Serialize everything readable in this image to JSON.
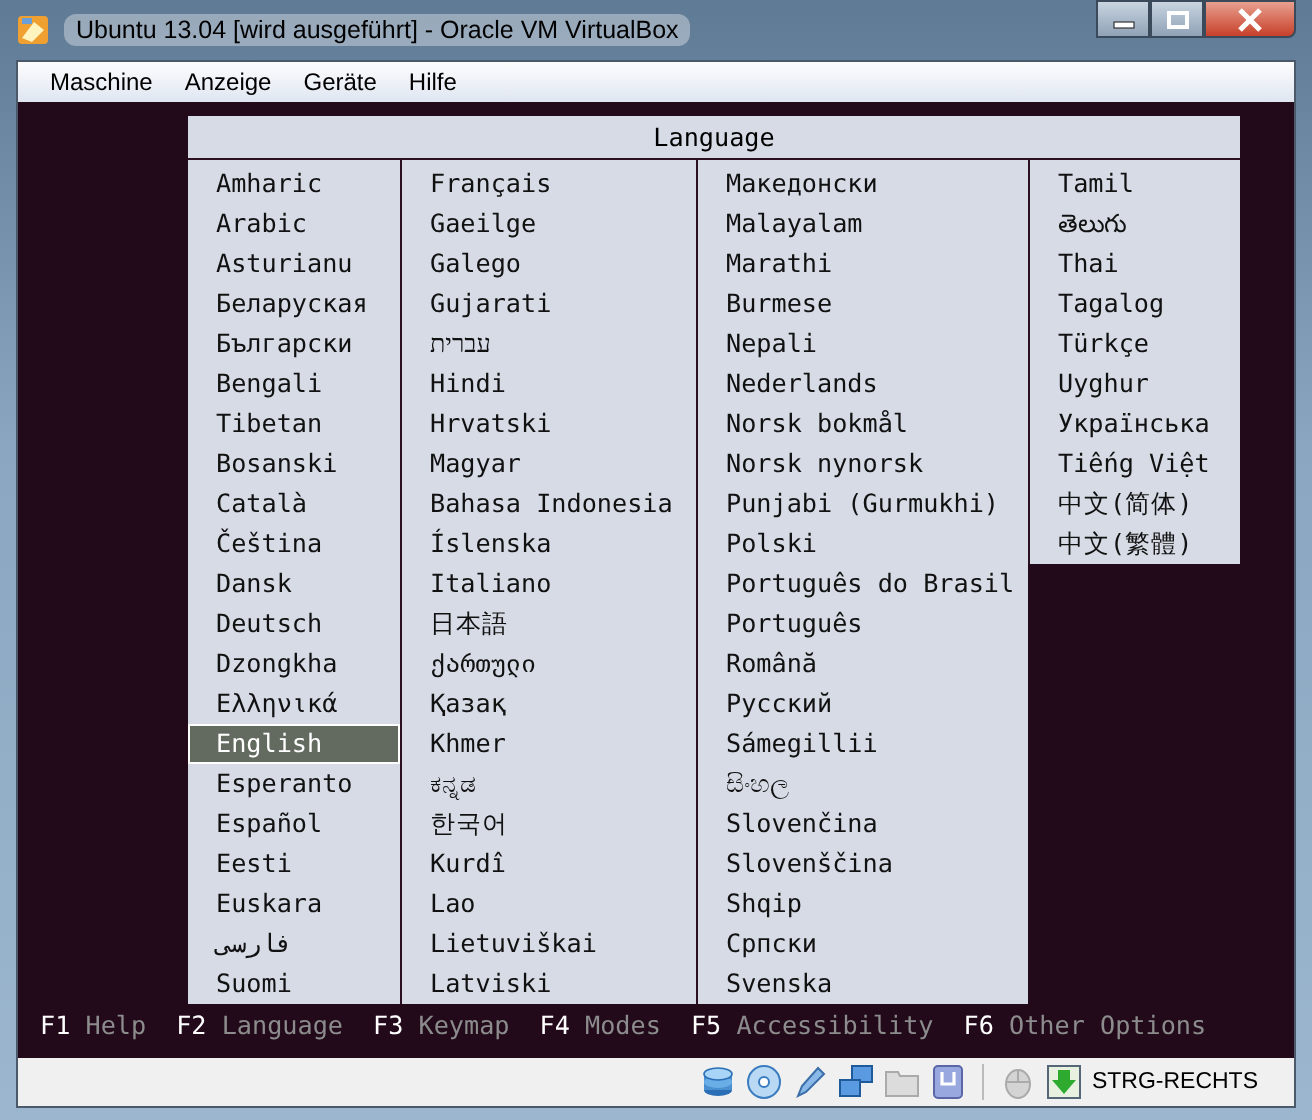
{
  "window": {
    "title": "Ubuntu 13.04 [wird ausgeführt] - Oracle VM VirtualBox"
  },
  "menu": [
    "Maschine",
    "Anzeige",
    "Geräte",
    "Hilfe"
  ],
  "language_menu": {
    "title": "Language",
    "columns": [
      {
        "items": [
          {
            "label": "Amharic",
            "selected": false
          },
          {
            "label": "Arabic",
            "selected": false
          },
          {
            "label": "Asturianu",
            "selected": false
          },
          {
            "label": "Беларуская",
            "selected": false
          },
          {
            "label": "Български",
            "selected": false
          },
          {
            "label": "Bengali",
            "selected": false
          },
          {
            "label": "Tibetan",
            "selected": false
          },
          {
            "label": "Bosanski",
            "selected": false
          },
          {
            "label": "Català",
            "selected": false
          },
          {
            "label": "Čeština",
            "selected": false
          },
          {
            "label": "Dansk",
            "selected": false
          },
          {
            "label": "Deutsch",
            "selected": false
          },
          {
            "label": "Dzongkha",
            "selected": false
          },
          {
            "label": "Ελληνικά",
            "selected": false
          },
          {
            "label": "English",
            "selected": true
          },
          {
            "label": "Esperanto",
            "selected": false
          },
          {
            "label": "Español",
            "selected": false
          },
          {
            "label": "Eesti",
            "selected": false
          },
          {
            "label": "Euskara",
            "selected": false
          },
          {
            "label": "فارسی",
            "selected": false
          },
          {
            "label": "Suomi",
            "selected": false
          }
        ]
      },
      {
        "items": [
          {
            "label": "Français",
            "selected": false
          },
          {
            "label": "Gaeilge",
            "selected": false
          },
          {
            "label": "Galego",
            "selected": false
          },
          {
            "label": "Gujarati",
            "selected": false
          },
          {
            "label": "עברית",
            "selected": false
          },
          {
            "label": "Hindi",
            "selected": false
          },
          {
            "label": "Hrvatski",
            "selected": false
          },
          {
            "label": "Magyar",
            "selected": false
          },
          {
            "label": "Bahasa Indonesia",
            "selected": false
          },
          {
            "label": "Íslenska",
            "selected": false
          },
          {
            "label": "Italiano",
            "selected": false
          },
          {
            "label": "日本語",
            "selected": false
          },
          {
            "label": "ქართული",
            "selected": false
          },
          {
            "label": "Қазақ",
            "selected": false
          },
          {
            "label": "Khmer",
            "selected": false
          },
          {
            "label": "ಕನ್ನಡ",
            "selected": false
          },
          {
            "label": "한국어",
            "selected": false
          },
          {
            "label": "Kurdî",
            "selected": false
          },
          {
            "label": "Lao",
            "selected": false
          },
          {
            "label": "Lietuviškai",
            "selected": false
          },
          {
            "label": "Latviski",
            "selected": false
          }
        ]
      },
      {
        "items": [
          {
            "label": "Македонски",
            "selected": false
          },
          {
            "label": "Malayalam",
            "selected": false
          },
          {
            "label": "Marathi",
            "selected": false
          },
          {
            "label": "Burmese",
            "selected": false
          },
          {
            "label": "Nepali",
            "selected": false
          },
          {
            "label": "Nederlands",
            "selected": false
          },
          {
            "label": "Norsk bokmål",
            "selected": false
          },
          {
            "label": "Norsk nynorsk",
            "selected": false
          },
          {
            "label": "Punjabi (Gurmukhi)",
            "selected": false
          },
          {
            "label": "Polski",
            "selected": false
          },
          {
            "label": "Português do Brasil",
            "selected": false
          },
          {
            "label": "Português",
            "selected": false
          },
          {
            "label": "Română",
            "selected": false
          },
          {
            "label": "Русский",
            "selected": false
          },
          {
            "label": "Sámegillii",
            "selected": false
          },
          {
            "label": "සිංහල",
            "selected": false
          },
          {
            "label": "Slovenčina",
            "selected": false
          },
          {
            "label": "Slovenščina",
            "selected": false
          },
          {
            "label": "Shqip",
            "selected": false
          },
          {
            "label": "Српски",
            "selected": false
          },
          {
            "label": "Svenska",
            "selected": false
          }
        ]
      },
      {
        "items": [
          {
            "label": "Tamil",
            "selected": false
          },
          {
            "label": "తెలుగు",
            "selected": false
          },
          {
            "label": "Thai",
            "selected": false
          },
          {
            "label": "Tagalog",
            "selected": false
          },
          {
            "label": "Türkçe",
            "selected": false
          },
          {
            "label": "Uyghur",
            "selected": false
          },
          {
            "label": "Українська",
            "selected": false
          },
          {
            "label": "Tiếng Việt",
            "selected": false
          },
          {
            "label": "中文(简体)",
            "selected": false
          },
          {
            "label": "中文(繁體)",
            "selected": false
          }
        ]
      }
    ]
  },
  "function_keys": [
    {
      "key": "F1",
      "label": "Help"
    },
    {
      "key": "F2",
      "label": "Language"
    },
    {
      "key": "F3",
      "label": "Keymap"
    },
    {
      "key": "F4",
      "label": "Modes"
    },
    {
      "key": "F5",
      "label": "Accessibility"
    },
    {
      "key": "F6",
      "label": "Other Options"
    }
  ],
  "status_bar": {
    "host_key": "STRG-RECHTS"
  }
}
